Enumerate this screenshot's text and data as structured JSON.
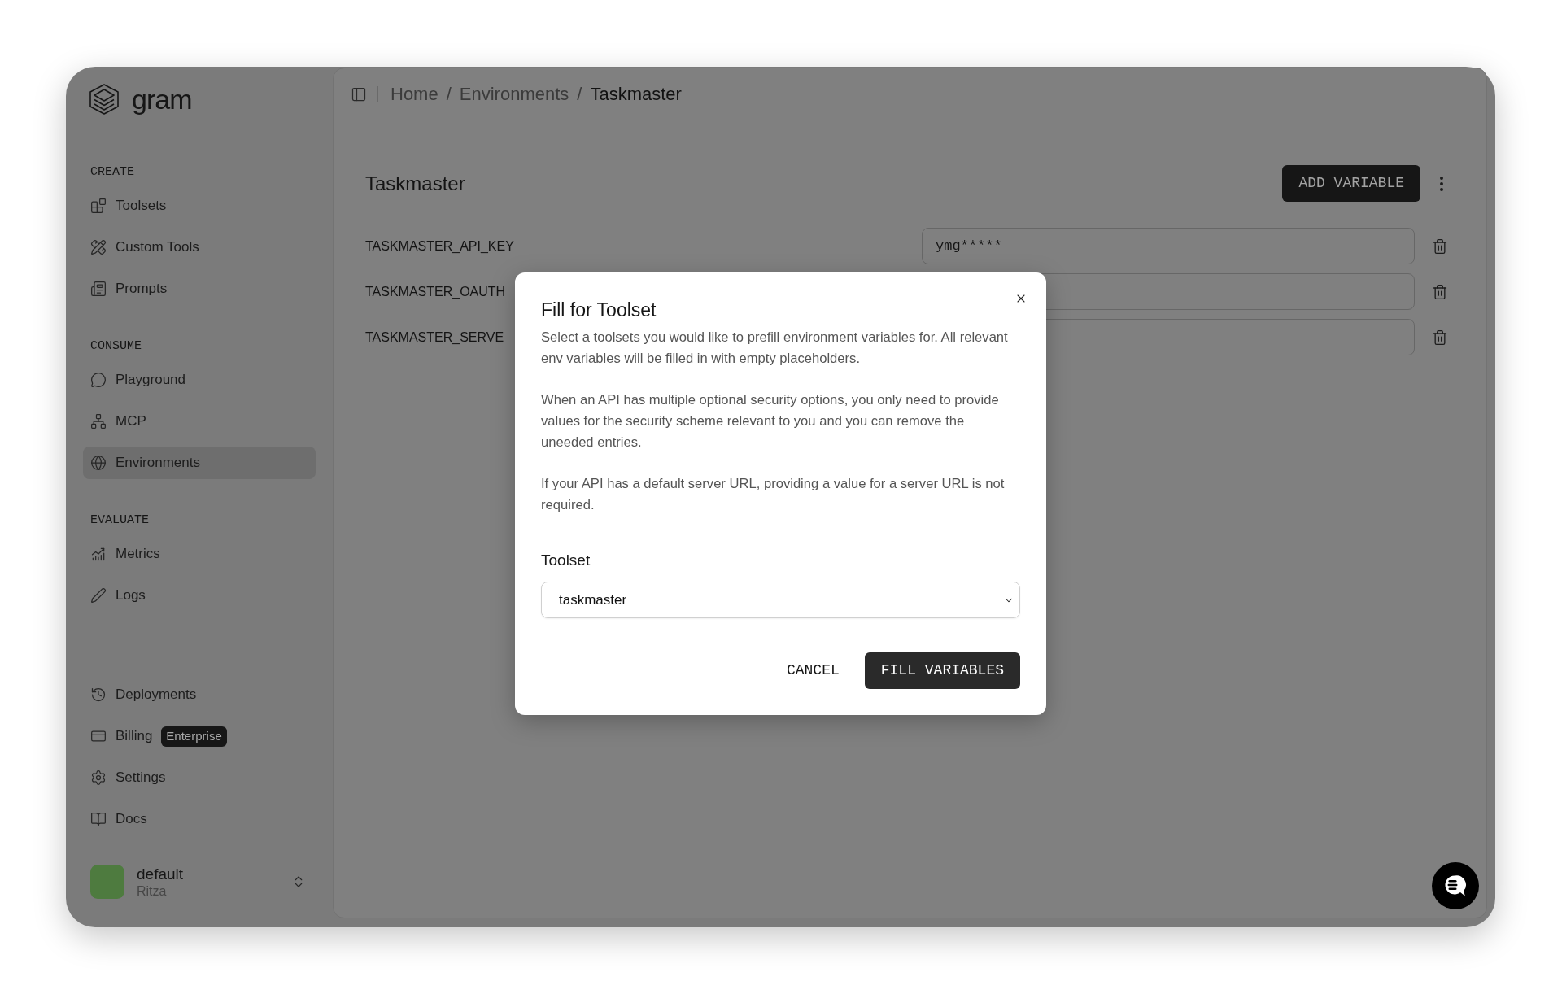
{
  "sidebar": {
    "logo_text": "gram",
    "sections": [
      {
        "title": "CREATE",
        "items": [
          {
            "label": "Toolsets",
            "selected": false
          },
          {
            "label": "Custom Tools",
            "selected": false
          },
          {
            "label": "Prompts",
            "selected": false
          }
        ]
      },
      {
        "title": "CONSUME",
        "items": [
          {
            "label": "Playground",
            "selected": false
          },
          {
            "label": "MCP",
            "selected": false
          },
          {
            "label": "Environments",
            "selected": true
          }
        ]
      },
      {
        "title": "EVALUATE",
        "items": [
          {
            "label": "Metrics",
            "selected": false
          },
          {
            "label": "Logs",
            "selected": false
          }
        ]
      }
    ],
    "footer_items": [
      {
        "label": "Deployments",
        "selected": false
      },
      {
        "label": "Billing",
        "selected": false,
        "badge": "Enterprise"
      },
      {
        "label": "Settings",
        "selected": false
      },
      {
        "label": "Docs",
        "selected": false
      }
    ],
    "workspace": {
      "name": "default",
      "org": "Ritza"
    }
  },
  "breadcrumb": [
    {
      "label": "Home",
      "current": false,
      "separator": "/"
    },
    {
      "label": "Environments",
      "current": false,
      "separator": "/"
    },
    {
      "label": "Taskmaster",
      "current": true
    }
  ],
  "environment": {
    "title": "Taskmaster",
    "add_button": "ADD VARIABLE",
    "variables": [
      {
        "name": "TASKMASTER_API_KEY",
        "value": "ymg*****"
      },
      {
        "name": "TASKMASTER_OAUTH"
      },
      {
        "name": "TASKMASTER_SERVE"
      }
    ]
  },
  "dialog": {
    "title": "Fill for Toolset",
    "paragraphs": [
      "Select a toolsets you would like to prefill environment variables for. All relevant env variables will be filled in with empty placeholders.",
      "When an API has multiple optional security options, you only need to provide values for the security scheme relevant to you and you can remove the uneeded entries.",
      "If your API has a default server URL, providing a value for a server URL is not required."
    ],
    "field_label": "Toolset",
    "select_value": "taskmaster",
    "buttons": [
      {
        "label": "CANCEL",
        "kind": "secondary"
      },
      {
        "label": "FILL VARIABLES",
        "kind": "primary"
      }
    ]
  }
}
